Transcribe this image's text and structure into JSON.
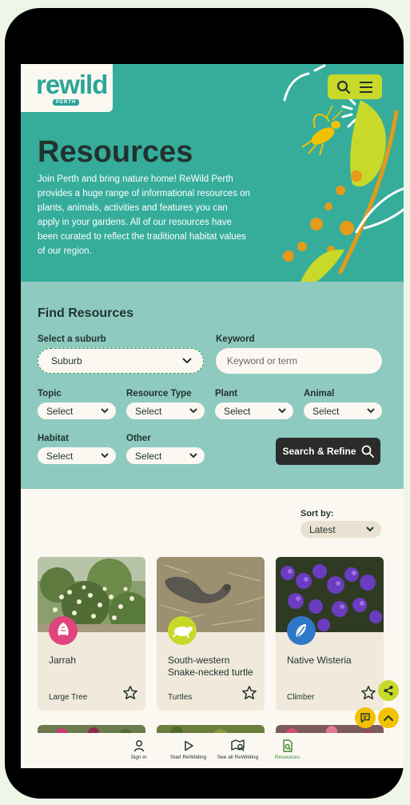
{
  "logo": {
    "word": "rewild",
    "sub": "PERTH"
  },
  "hero": {
    "title": "Resources",
    "description": "Join Perth and bring nature home! ReWild Perth provides a huge range of informational resources on plants, animals, activities and features you can apply in your gardens. All of our resources have been curated to reflect the traditional habitat values of our region."
  },
  "filters": {
    "title": "Find Resources",
    "suburb_label": "Select a suburb",
    "suburb_value": "Suburb",
    "keyword_label": "Keyword",
    "keyword_placeholder": "Keyword or term",
    "topic_label": "Topic",
    "resource_type_label": "Resource Type",
    "plant_label": "Plant",
    "animal_label": "Animal",
    "habitat_label": "Habitat",
    "other_label": "Other",
    "select_value": "Select",
    "search_label": "Search & Refine"
  },
  "sort": {
    "label": "Sort by:",
    "value": "Latest"
  },
  "cards": [
    {
      "name": "Jarrah",
      "category": "Large Tree",
      "badge_color": "#e0447d"
    },
    {
      "name": "South-western Snake-necked turtle",
      "category": "Turtles",
      "badge_color": "#c9d92a"
    },
    {
      "name": "Native Wisteria",
      "category": "Climber",
      "badge_color": "#2f78c8"
    }
  ],
  "bottom_nav": [
    {
      "label": "Sign in",
      "icon": "person-icon"
    },
    {
      "label": "Start ReWilding",
      "icon": "play-icon"
    },
    {
      "label": "See all ReWilding",
      "icon": "map-search-icon"
    },
    {
      "label": "Resources",
      "icon": "document-search-icon"
    }
  ],
  "colors": {
    "teal": "#36ad9b",
    "light_teal": "#8ecac0",
    "lime": "#c9d92a",
    "cream": "#fbf8f1",
    "dark": "#21332f"
  }
}
